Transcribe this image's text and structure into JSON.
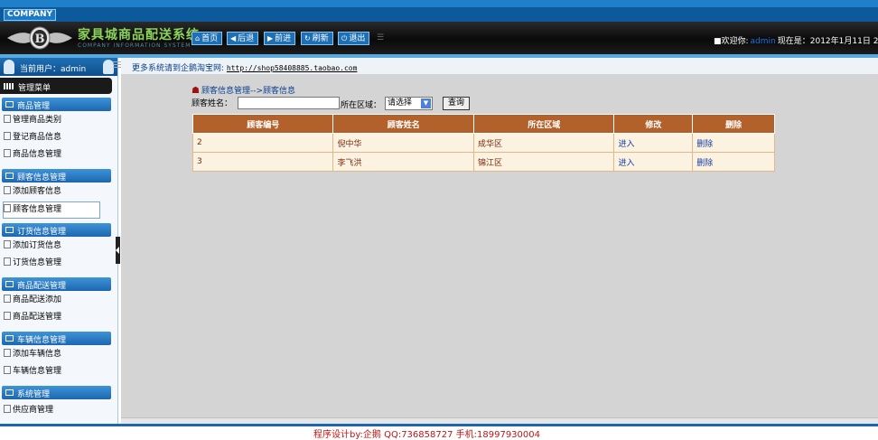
{
  "header": {
    "company": "COMPANY",
    "brand_title": "家具城商品配送系统",
    "brand_sub": "COMPANY INFORMATION SYSTEM",
    "nav": [
      {
        "label": "首页",
        "icon": "home-icon"
      },
      {
        "label": "后退",
        "icon": "arrow-left-icon"
      },
      {
        "label": "前进",
        "icon": "arrow-right-icon"
      },
      {
        "label": "刷新",
        "icon": "refresh-icon"
      },
      {
        "label": "退出",
        "icon": "power-icon"
      }
    ],
    "welcome_prefix": "■欢迎你:",
    "welcome_user": "admin",
    "date_text": "现在是：2012年1月11日 2"
  },
  "sidebar": {
    "current_user": "当前用户：admin",
    "menu_title": "管理菜单",
    "groups": [
      {
        "title": "商品管理",
        "items": [
          "管理商品类别",
          "登记商品信息",
          "商品信息管理"
        ]
      },
      {
        "title": "顾客信息管理",
        "items": [
          "添加顾客信息",
          "顾客信息管理"
        ]
      },
      {
        "title": "订货信息管理",
        "items": [
          "添加订货信息",
          "订货信息管理"
        ]
      },
      {
        "title": "商品配送管理",
        "items": [
          "商品配送添加",
          "商品配送管理"
        ]
      },
      {
        "title": "车辆信息管理",
        "items": [
          "添加车辆信息",
          "车辆信息管理"
        ]
      },
      {
        "title": "系统管理",
        "items": [
          "供应商管理"
        ]
      }
    ]
  },
  "info_bar": {
    "text": "更多系统请到企鹅淘宝网:",
    "link": "http://shop58408885.taobao.com"
  },
  "main": {
    "breadcrumb": "顾客信息管理-->顾客信息",
    "search": {
      "name_label": "顾客姓名：",
      "name_value": "",
      "region_label": "所在区域：",
      "region_selected": "请选择",
      "query_label": "查询"
    },
    "table": {
      "headers": [
        "顾客编号",
        "顾客姓名",
        "所在区域",
        "修改",
        "删除"
      ],
      "rows": [
        [
          "2",
          "倪中华",
          "成华区",
          "进入",
          "删除"
        ],
        [
          "3",
          "李飞洪",
          "锦江区",
          "进入",
          "删除"
        ]
      ]
    }
  },
  "footer": {
    "text": "程序设计by:企鹅   QQ:736858727   手机:18997930004"
  },
  "colors": {
    "header_blue": "#0c5a9c",
    "table_header": "#b2612a",
    "table_row": "#fbf2e2",
    "footer_text": "#c01515"
  }
}
